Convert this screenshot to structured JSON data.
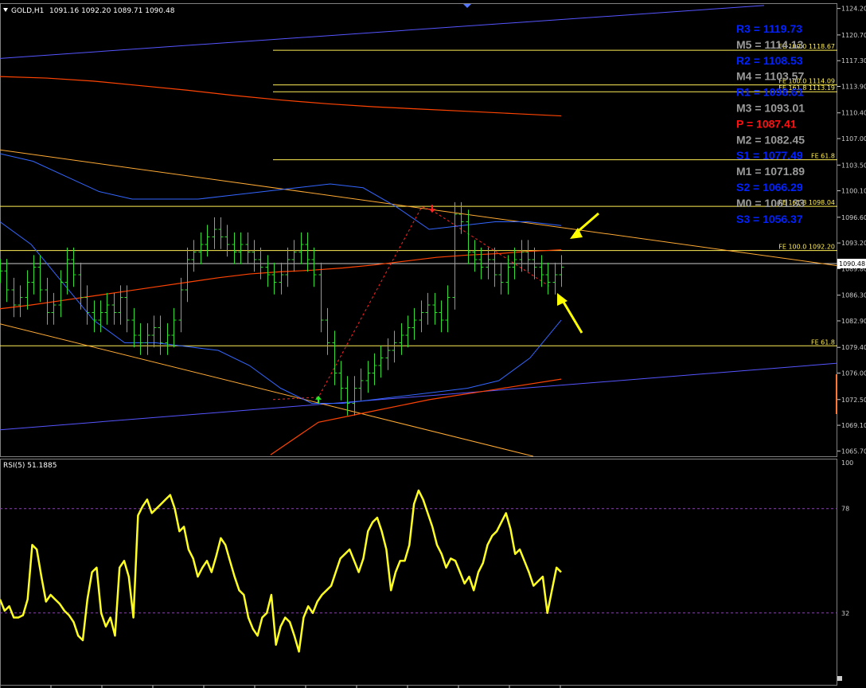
{
  "header": {
    "symbol": "GOLD,H1",
    "ohlc": "1091.16 1092.20 1089.71 1090.48"
  },
  "rsi_header": "RSI(5) 51.1885",
  "colors": {
    "background": "#000000",
    "grid": "#404040",
    "candle": "#33dd33",
    "ma_red": "#ff4400",
    "bollinger": "#3366ff",
    "channel_blue": "#5555ff",
    "trend_orange": "#ffaa33",
    "level_yellow": "#ffee55",
    "rsi": "#ffff22",
    "pivot_blue": "#0022ff",
    "pivot_gray": "#9a9a9a",
    "pivot_red": "#ff1111",
    "arrow": "#ffff00",
    "axis_text": "#cccccc"
  },
  "chart_data": [
    {
      "type": "line",
      "name": "GOLD,H1 price",
      "title": "GOLD,H1",
      "y_axis_ticks": [
        1124.2,
        1120.7,
        1117.3,
        1113.9,
        1110.4,
        1107.0,
        1103.5,
        1100.1,
        1096.6,
        1093.2,
        1089.8,
        1086.3,
        1082.9,
        1079.4,
        1076.0,
        1072.5,
        1069.1,
        1065.7
      ],
      "y_axis_labels": [
        "1124.20",
        "1120.70",
        "1117.30",
        "1113.90",
        "1110.40",
        "1107.00",
        "1103.50",
        "1100.10",
        "1096.60",
        "1093.20",
        "1089.80",
        "1086.30",
        "1082.90",
        "1079.40",
        "1076.00",
        "1072.50",
        "1069.10",
        "1065.70"
      ],
      "ylim": [
        1065.0,
        1124.9
      ],
      "current_price": 1090.48,
      "current_price_label": "1090.48",
      "close_series": [
        1089.5,
        1087,
        1085,
        1086,
        1088,
        1090,
        1087,
        1084,
        1085,
        1088,
        1091,
        1089,
        1086,
        1084,
        1083,
        1084,
        1085,
        1084,
        1086,
        1083,
        1081,
        1080,
        1081,
        1082,
        1080,
        1081,
        1083,
        1087,
        1091,
        1092,
        1093,
        1094,
        1095,
        1094,
        1093,
        1092,
        1093,
        1092,
        1091,
        1090,
        1089,
        1088,
        1089,
        1091,
        1092,
        1093,
        1091,
        1089,
        1083,
        1080,
        1076,
        1074,
        1072,
        1074,
        1075,
        1076,
        1077,
        1078,
        1079,
        1080,
        1081,
        1082,
        1083,
        1084,
        1085,
        1084,
        1083,
        1086,
        1097,
        1096,
        1092,
        1091,
        1090,
        1091,
        1089,
        1088,
        1090,
        1091,
        1092,
        1091,
        1090,
        1089,
        1088,
        1089,
        1090
      ],
      "moving_average_short": [
        1084.5,
        1085,
        1085.6,
        1086.2,
        1086.8,
        1087.4,
        1088,
        1088.6,
        1089.1,
        1089.4,
        1089.6,
        1089.9,
        1090.3,
        1090.8,
        1091.3,
        1091.6,
        1091.8,
        1092.1,
        1092.3
      ],
      "moving_average_long": [
        1115.2,
        1115,
        1114.6,
        1114,
        1113.4,
        1112.7,
        1112.1,
        1111.6,
        1111.2,
        1110.9,
        1110.6,
        1110.3,
        1110
      ],
      "bollinger_upper": [
        1105,
        1104,
        1102,
        1100,
        1099,
        1099,
        1099,
        1099.5,
        1100,
        1100.5,
        1101,
        1100.5,
        1098,
        1095,
        1095.5,
        1096,
        1096,
        1095.5
      ],
      "bollinger_lower": [
        1096,
        1093,
        1088,
        1083,
        1080,
        1080,
        1079.5,
        1079,
        1077,
        1074,
        1072,
        1072,
        1072.5,
        1073,
        1073.5,
        1074,
        1075,
        1078,
        1083
      ],
      "level_lines": [
        {
          "price": 1118.67,
          "label": "FE 100.0 1118.67"
        },
        {
          "price": 1114.09,
          "label": "FE 100.0 1114.09"
        },
        {
          "price": 1113.19,
          "label": "FE 161.8 1113.19"
        },
        {
          "price": 1104.2,
          "label": "FE 61.8"
        },
        {
          "price": 1098.04,
          "label": "FE 161.8 1098.04"
        },
        {
          "price": 1092.2,
          "label": "FE 100.0 1092.20"
        },
        {
          "price": 1079.6,
          "label": "FE 61.8"
        }
      ],
      "pivots": [
        {
          "label": "R3 = 1119.73",
          "tone": "blue"
        },
        {
          "label": "M5 = 1114.13",
          "tone": "gray"
        },
        {
          "label": "R2 = 1108.53",
          "tone": "blue"
        },
        {
          "label": "M4 = 1103.57",
          "tone": "gray"
        },
        {
          "label": "R1 = 1098.61",
          "tone": "blue"
        },
        {
          "label": "M3 = 1093.01",
          "tone": "gray"
        },
        {
          "label": "P  = 1087.41",
          "tone": "red"
        },
        {
          "label": "M2 = 1082.45",
          "tone": "gray"
        },
        {
          "label": "S1 = 1077.49",
          "tone": "blue"
        },
        {
          "label": "M1 = 1071.89",
          "tone": "gray"
        },
        {
          "label": "S2 = 1066.29",
          "tone": "blue"
        },
        {
          "label": "M0 = 1061.33",
          "tone": "gray"
        },
        {
          "label": "S3 = 1056.37",
          "tone": "blue"
        }
      ]
    },
    {
      "type": "line",
      "name": "RSI(5)",
      "title": "RSI(5) 51.1885",
      "ylim": [
        0,
        100
      ],
      "y_axis_labels": [
        "100",
        "78",
        "32"
      ],
      "levels": [
        78,
        32
      ],
      "values": [
        38,
        33,
        35,
        30,
        30,
        31,
        38,
        62,
        60,
        48,
        37,
        40,
        38,
        36,
        33,
        31,
        28,
        22,
        20,
        38,
        50,
        52,
        32,
        26,
        30,
        22,
        52,
        55,
        48,
        30,
        75,
        79,
        82,
        76,
        78,
        80,
        82,
        84,
        78,
        68,
        70,
        60,
        56,
        48,
        52,
        55,
        50,
        57,
        65,
        62,
        55,
        48,
        42,
        40,
        30,
        25,
        22,
        30,
        32,
        40,
        18,
        26,
        30,
        28,
        22,
        15,
        30,
        35,
        32,
        37,
        40,
        42,
        44,
        50,
        56,
        58,
        60,
        55,
        50,
        56,
        68,
        72,
        74,
        68,
        60,
        42,
        50,
        55,
        55,
        62,
        80,
        86,
        82,
        76,
        70,
        62,
        58,
        52,
        56,
        55,
        50,
        45,
        48,
        42,
        50,
        54,
        62,
        66,
        68,
        72,
        76,
        69,
        58,
        60,
        55,
        50,
        44,
        46,
        48,
        32,
        42,
        52,
        50
      ]
    }
  ]
}
